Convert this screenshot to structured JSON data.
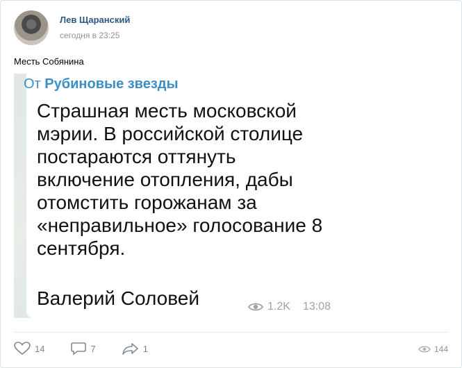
{
  "post": {
    "author": "Лев Щаранский",
    "time": "сегодня в 23:25",
    "text": "Месть Собянина"
  },
  "repost": {
    "from_prefix": "От",
    "from_channel": "Рубиновые звезды",
    "quote": "Страшная месть московской мэрии. В российской столице постараются оттянуть включение отопления, дабы отомстить горожанам за «неправильное» голосование 8 сентября.",
    "signature": "Валерий Соловей",
    "views": "1.2K",
    "time": "13:08"
  },
  "actions": {
    "likes": "14",
    "comments": "7",
    "shares": "1",
    "views": "144"
  },
  "icons": {
    "like": "heart-icon",
    "comment": "comment-icon",
    "share": "share-icon",
    "views": "eye-icon"
  },
  "colors": {
    "author": "#2a5885",
    "channel": "#3a8fc7",
    "muted": "#939393"
  }
}
